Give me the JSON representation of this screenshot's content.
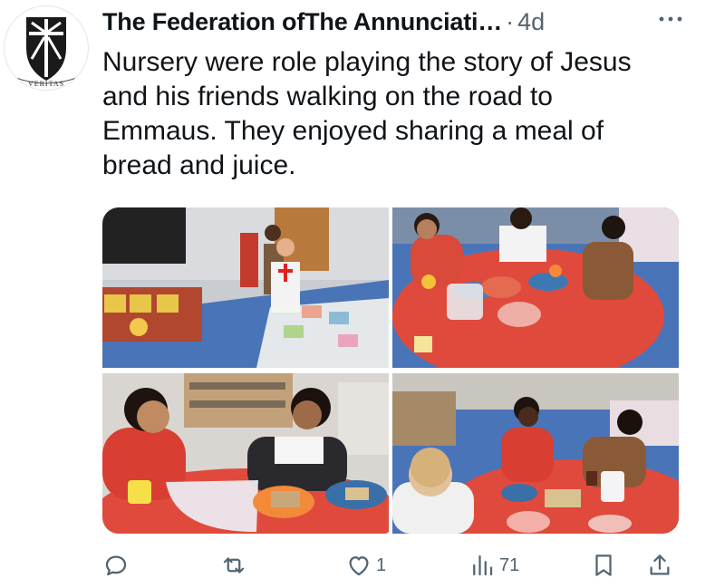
{
  "avatar": {
    "badge_text": "VERITAS",
    "colors": {
      "shield": "#1a1a1a",
      "bg": "#ffffff"
    }
  },
  "tweet": {
    "author": "The Federation ofThe Annunciati…",
    "separator": "·",
    "time": "4d",
    "more_icon": "ellipsis-icon",
    "lines": [
      "Nursery were role playing the story of Jesus",
      "and his friends walking on the road to",
      "Emmaus. They enjoyed sharing a meal of",
      "bread and juice."
    ]
  },
  "media": {
    "photos": [
      {
        "name": "photo-role-play-classroom"
      },
      {
        "name": "photo-children-at-red-table"
      },
      {
        "name": "photo-girl-and-boy-eating"
      },
      {
        "name": "photo-children-sharing-meal"
      }
    ]
  },
  "actions": {
    "reply": {
      "icon": "reply-icon",
      "count": ""
    },
    "repost": {
      "icon": "repost-icon",
      "count": ""
    },
    "like": {
      "icon": "heart-icon",
      "count": "1"
    },
    "views": {
      "icon": "views-icon",
      "count": "71"
    },
    "bookmark": {
      "icon": "bookmark-icon"
    },
    "share": {
      "icon": "share-icon"
    }
  },
  "colors": {
    "text": "#0f1419",
    "muted": "#536471",
    "table_red": "#e04a3c",
    "floor_blue": "#4a74b8"
  }
}
